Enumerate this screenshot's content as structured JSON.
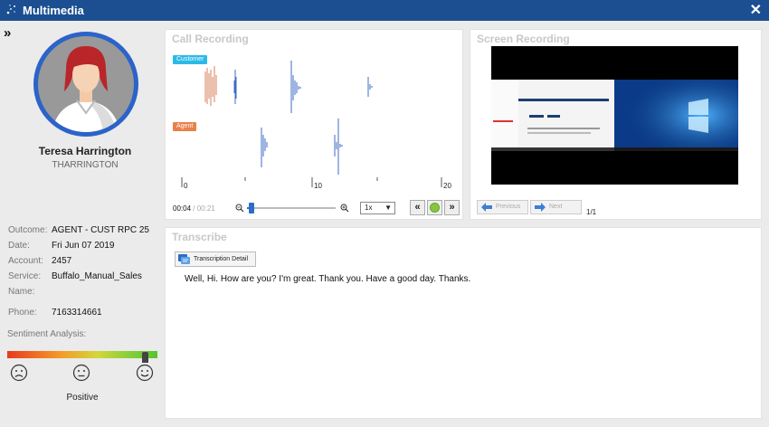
{
  "window": {
    "title": "Multimedia",
    "close_icon": "close-icon"
  },
  "agent": {
    "name": "Teresa Harrington",
    "username": "THARRINGTON"
  },
  "call_info": [
    {
      "label": "Outcome:",
      "value": "AGENT - CUST RPC 25"
    },
    {
      "label": "Date:",
      "value": "Fri Jun 07 2019"
    },
    {
      "label": "Account:",
      "value": "2457"
    },
    {
      "label": "Service:",
      "value": "Buffalo_Manual_Sales"
    },
    {
      "label": "Name:",
      "value": ""
    },
    {
      "label": "Phone:",
      "value": "7163314661"
    }
  ],
  "sentiment": {
    "label": "Sentiment Analysis:",
    "value": "Positive",
    "level": 0.92
  },
  "call_recording": {
    "title": "Call Recording",
    "customer_label": "Customer",
    "agent_label": "Agent",
    "ticks": [
      "0",
      "10",
      "20"
    ],
    "current_time": "00:04",
    "separator": " / ",
    "total_time": "00:21",
    "speed": "1x",
    "colors": {
      "customer": "#2bb9e6",
      "agent": "#e8814a",
      "wave_blue": "#3d6bc9",
      "wave_orange": "#d9825a"
    }
  },
  "screen_recording": {
    "title": "Screen Recording",
    "previous_label": "Previous",
    "next_label": "Next",
    "page": "1/1"
  },
  "transcribe": {
    "title": "Transcribe",
    "detail_button": "Transcription Detail",
    "text": "Well, Hi. How are you? I'm great. Thank you. Have a good day. Thanks."
  }
}
